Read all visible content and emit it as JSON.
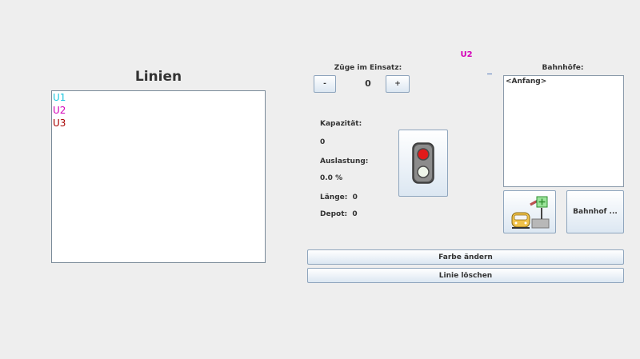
{
  "linien_panel": {
    "title": "Linien",
    "lines": [
      {
        "label": "U1",
        "color": "#1ec8e0"
      },
      {
        "label": "U2",
        "color": "#d400b8"
      },
      {
        "label": "U3",
        "color": "#a80000"
      }
    ]
  },
  "selected_line": {
    "label": "U2",
    "color": "#d400b8"
  },
  "trains": {
    "label": "Züge im Einsatz:",
    "minus_label": "-",
    "plus_label": "+",
    "count": "0"
  },
  "stats": {
    "kapazitaet_label": "Kapazität:",
    "kapazitaet_value": "0",
    "auslastung_label": "Auslastung:",
    "auslastung_value": "0.0 %",
    "laenge": "Länge:  0",
    "depot": "Depot:  0"
  },
  "signal": {
    "icon": "traffic-light-icon",
    "state": "red"
  },
  "stations": {
    "label": "Bahnhöfe:",
    "items": [
      "<Anfang>"
    ],
    "add_station_icon": "train-station-add-icon",
    "station_button_label": "Bahnhof ..."
  },
  "actions": {
    "change_color_label": "Farbe ändern",
    "delete_line_label": "Linie löschen"
  }
}
